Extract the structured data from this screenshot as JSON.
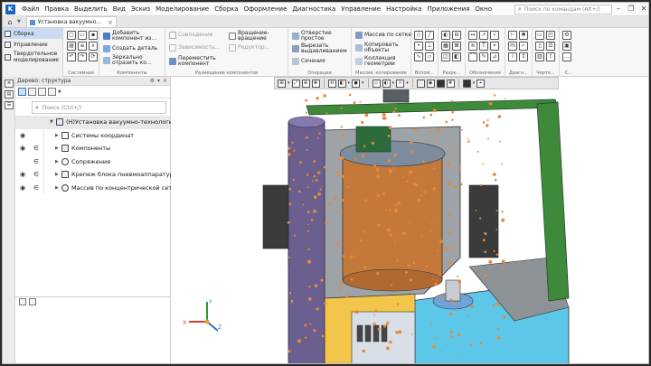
{
  "menubar": {
    "items": [
      "Файл",
      "Правка",
      "Выделить",
      "Вид",
      "Эскиз",
      "Моделирование",
      "Сборка",
      "Оформление",
      "Диагностика",
      "Управление",
      "Настройка",
      "Приложения",
      "Окно"
    ],
    "search_placeholder": "Поиск по командам (Alt+/)"
  },
  "tabbar": {
    "doc_tab_title": "Установка вакуумно..."
  },
  "ribbon": {
    "modes": [
      "Сборка",
      "Управление",
      "Твердотельное моделирование"
    ],
    "groups": {
      "system": "Системная",
      "components": "Компоненты",
      "placement": "Размещение компонентов",
      "operations": "Операции",
      "arrays": "Массив, копирование",
      "auxiliary": "Вспом...",
      "cuts": "Разре...",
      "markup": "Обозначения",
      "diagnostics": "Диагн...",
      "drawing": "Черте...",
      "other": "С..."
    },
    "buttons": {
      "add_component": "Добавить компонент из...",
      "create_part": "Создать деталь",
      "mirror_component": "Зеркально отразить ко...",
      "coincident": "Совпадение",
      "rotate_roll": "Вращение-вращение",
      "move_component": "Переместить компонент",
      "hole_simple": "Отверстие простое",
      "extrude_cut": "Вырезать выдавливанием",
      "sections": "Сечения",
      "array_grid": "Массив по сетке",
      "copy_objects": "Копировать объекты",
      "geometry_collection": "Коллекция геометрии",
      "dim_sim": "Зависимость...",
      "dim_gear": "Редуктор..."
    }
  },
  "tree": {
    "header": "Дерево: структура",
    "search_placeholder": "Поиск (Ctrl+/)",
    "rows": [
      {
        "label": "(Н)Установка вакуумно-технологическ"
      },
      {
        "label": "Системы координат"
      },
      {
        "label": "Компоненты"
      },
      {
        "label": "Сопряжения"
      },
      {
        "label": "Крепеж блока пневмоаппаратуры"
      },
      {
        "label": "Массив по концентрической сетке"
      }
    ]
  },
  "viewport": {
    "triad_labels": {
      "x": "X",
      "y": "Y",
      "z": "Z"
    }
  },
  "colors": {
    "accent": "#1565c0",
    "frame_green": "#3f8a3a",
    "gray_metal": "#8d9296",
    "purple_metal": "#6a5f8f",
    "orange_fastener": "#e58a3c",
    "cyan_base": "#5cc7e8"
  }
}
